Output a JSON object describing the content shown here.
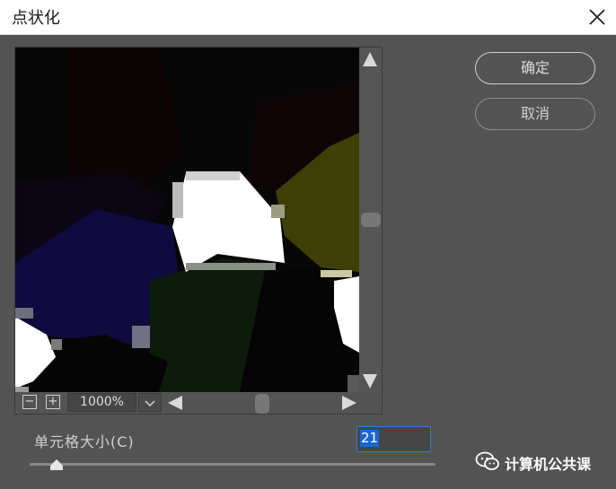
{
  "dialog": {
    "title": "点状化",
    "close_icon": "close-icon"
  },
  "buttons": {
    "ok_label": "确定",
    "cancel_label": "取消"
  },
  "preview": {
    "zoom_value": "1000%",
    "zoom_out_symbol": "−",
    "zoom_in_symbol": "+",
    "scroll_arrow_color": "#d9d9d9"
  },
  "cell_size": {
    "label": "单元格大小(C)",
    "value": "21",
    "slider_fraction": 0.07
  },
  "watermark": {
    "text": "计算机公共课",
    "icon": "wechat-icon"
  },
  "colors": {
    "dialog_bg": "#535353",
    "title_bar_bg": "#ffffff",
    "selection_blue": "#1a66d1"
  }
}
